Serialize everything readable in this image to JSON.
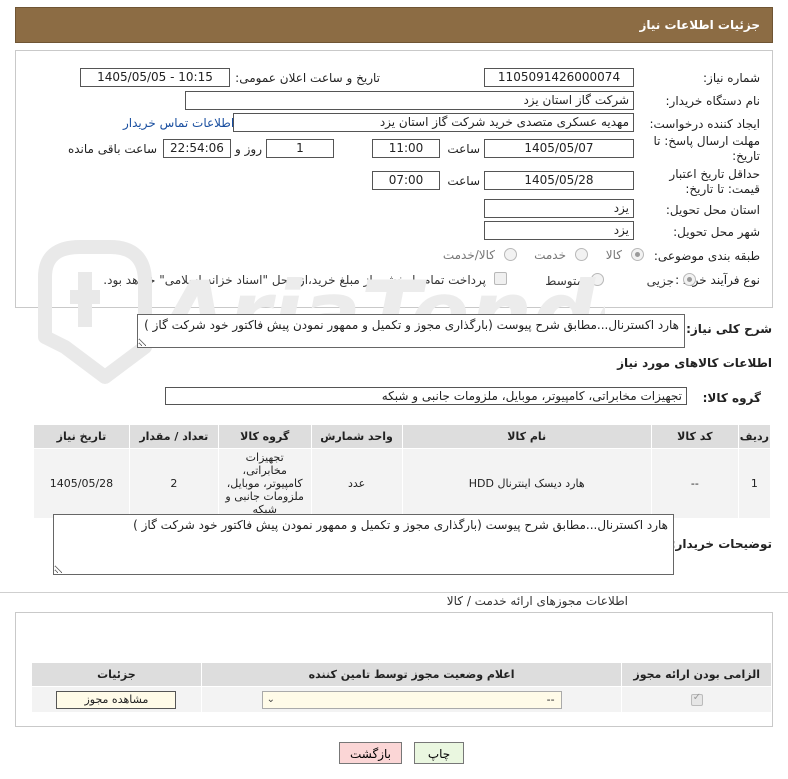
{
  "header": {
    "title": "جزئیات اطلاعات نیاز"
  },
  "watermark": {
    "text": "AriaTender.net"
  },
  "form": {
    "need_number_label": "شماره نیاز:",
    "need_number": "1105091426000074",
    "announce_label": "تاریخ و ساعت اعلان عمومی:",
    "announce_value": "1405/05/05 - 10:15",
    "buyer_org_label": "نام دستگاه خریدار:",
    "buyer_org": "شرکت گاز استان یزد",
    "creator_label": "ایجاد کننده درخواست:",
    "creator": "مهدیه عسکری متصدی خرید شرکت گاز استان یزد",
    "contact_link": "اطلاعات تماس خریدار",
    "reply_deadline_label": "مهلت ارسال پاسخ: تا تاریخ:",
    "reply_date": "1405/05/07",
    "time_label": "ساعت",
    "reply_time": "11:00",
    "days_value": "1",
    "days_label": "روز و",
    "remaining_time": "22:54:06",
    "remaining_label": "ساعت باقی مانده",
    "validity_label": "حداقل تاریخ اعتبار قیمت: تا تاریخ:",
    "validity_date": "1405/05/28",
    "validity_time": "07:00",
    "province_label": "استان محل تحویل:",
    "province": "یزد",
    "city_label": "شهر محل تحویل:",
    "city": "یزد",
    "category_label": "طبقه بندی موضوعی:",
    "category_options": [
      "کالا",
      "خدمت",
      "کالا/خدمت"
    ],
    "process_label": "نوع فرآیند خرید :",
    "process_options": [
      "جزیی",
      "متوسط"
    ],
    "payment_note": "پرداخت تمام یا بخشی از مبلغ خرید،از محل \"اسناد خزانه اسلامی\" خواهد بود."
  },
  "summary": {
    "label": "شرح کلی نیاز:",
    "text": "هارد اکسترنال...مطابق شرح پیوست (بارگذاری مجوز و تکمیل و ممهور نمودن پیش فاکتور خود شرکت گاز )"
  },
  "goods": {
    "section_title": "اطلاعات کالاهای مورد نیاز",
    "group_label": "گروه کالا:",
    "group_value": "تجهیزات مخابراتی، کامپیوتر، موبایل، ملزومات جانبی و شبکه",
    "columns": [
      "ردیف",
      "کد کالا",
      "نام کالا",
      "واحد شمارش",
      "گروه کالا",
      "تعداد / مقدار",
      "تاریخ نیاز"
    ],
    "rows": [
      {
        "index": "1",
        "code": "--",
        "name": "هارد دیسک اینترنال HDD",
        "unit": "عدد",
        "group": "تجهیزات مخابراتی، کامپیوتر، موبایل، ملزومات جانبی و شبکه",
        "qty": "2",
        "date": "1405/05/28"
      }
    ]
  },
  "buyer_notes": {
    "label": "توضیحات خریدار:",
    "text": "هارد اکسترنال...مطابق شرح پیوست (بارگذاری مجوز و تکمیل و ممهور نمودن پیش فاکتور خود شرکت گاز )"
  },
  "permits": {
    "section_title": "اطلاعات مجوزهای ارائه خدمت / کالا",
    "columns": [
      "الزامی بودن ارائه مجوز",
      "اعلام وضعیت مجوز توسط تامین کننده",
      "جزئیات"
    ],
    "select_value": "--",
    "view_button": "مشاهده مجوز"
  },
  "actions": {
    "print": "چاپ",
    "back": "بازگشت"
  }
}
